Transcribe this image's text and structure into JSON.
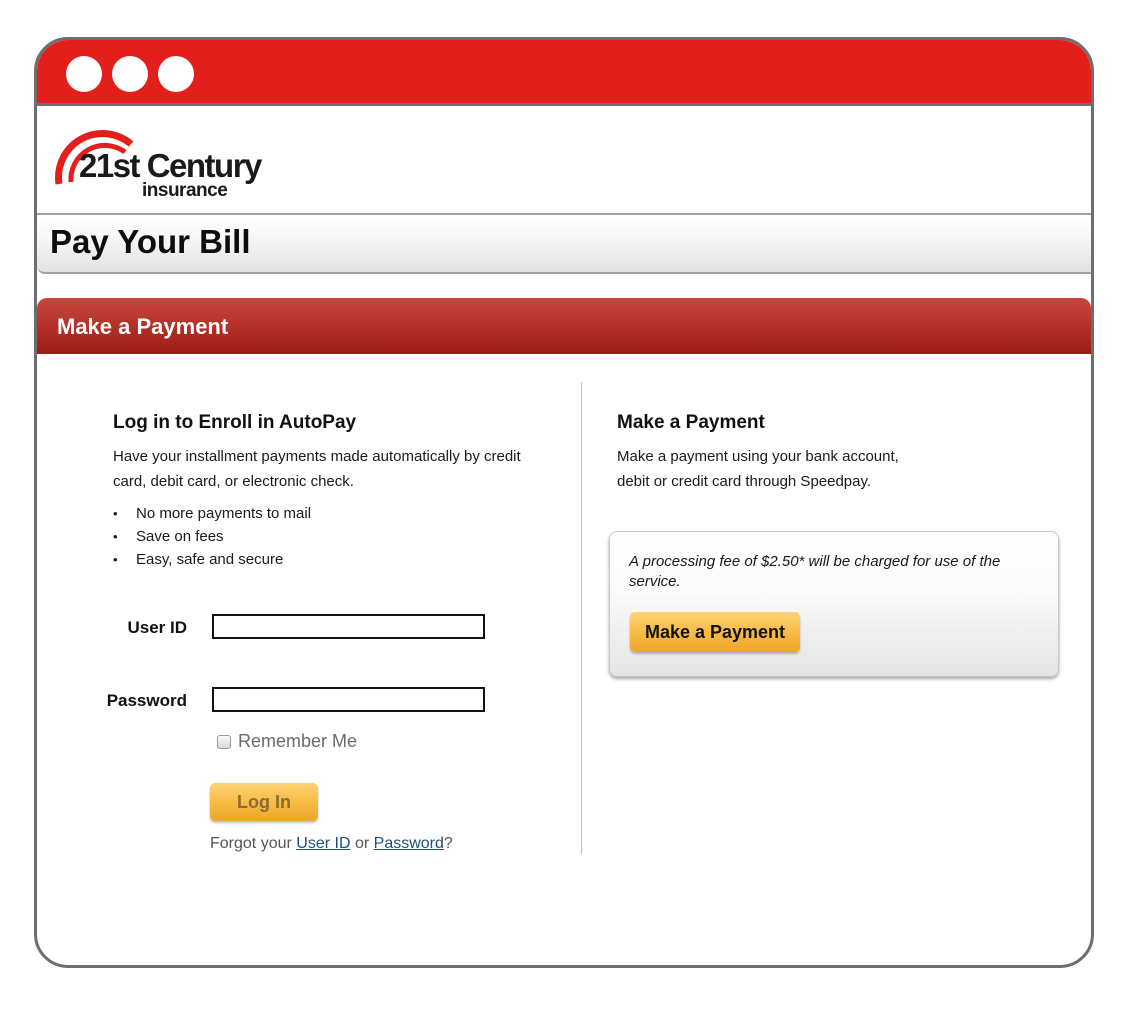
{
  "window": {
    "titlebar_color": "#e21f1b",
    "controls": [
      "window-dot",
      "window-dot",
      "window-dot"
    ]
  },
  "brand": {
    "name": "21st Century",
    "subtitle": "insurance",
    "accent": "#e21f1b"
  },
  "page": {
    "title": "Pay Your Bill"
  },
  "section": {
    "title": "Make a Payment",
    "color": "#b43129"
  },
  "autopay": {
    "heading": "Log in to Enroll in AutoPay",
    "description": "Have your installment payments made automatically by credit card, debit card, or electronic check.",
    "benefits": [
      "No more payments to mail",
      "Save on fees",
      "Easy, safe and secure"
    ],
    "user_id_label": "User ID",
    "user_id_value": "",
    "password_label": "Password",
    "password_value": "",
    "remember_label": "Remember Me",
    "remember_checked": false,
    "login_label": "Log In",
    "forgot_prefix": "Forgot your",
    "forgot_user_id": "User ID",
    "forgot_or": "or",
    "forgot_password": "Password",
    "forgot_suffix": "?"
  },
  "payment": {
    "heading": "Make a Payment",
    "description_line1": "Make a payment using your bank account,",
    "description_line2": "debit or credit card through Speedpay.",
    "fee_notice": "A processing fee of $2.50* will be charged for use of the service.",
    "button_label": "Make a Payment"
  }
}
